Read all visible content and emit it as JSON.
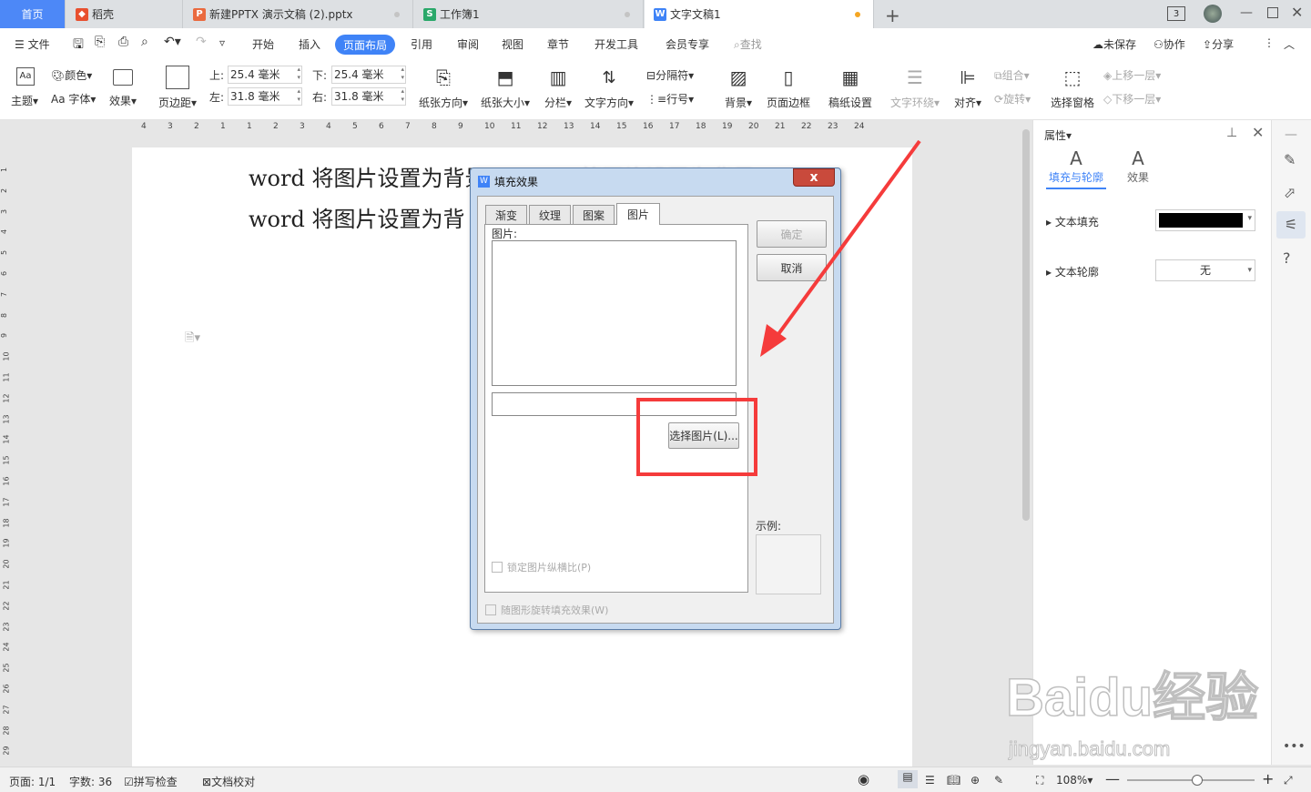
{
  "tabs": [
    {
      "label": "首页"
    },
    {
      "label": "稻壳"
    },
    {
      "label": "新建PPTX 演示文稿 (2).pptx"
    },
    {
      "label": "工作簿1"
    },
    {
      "label": "文字文稿1"
    }
  ],
  "tab_badge": "3",
  "menu": {
    "file": "文件",
    "items": [
      "开始",
      "插入",
      "页面布局",
      "引用",
      "审阅",
      "视图",
      "章节",
      "开发工具",
      "会员专享"
    ],
    "search": "查找",
    "unsaved": "未保存",
    "collab": "协作",
    "share": "分享"
  },
  "ribbon": {
    "theme": "主题",
    "color": "颜色",
    "font": "字体",
    "effect": "效果",
    "margins": "页边距",
    "top_label": "上:",
    "top_value": "25.4 毫米",
    "bottom_label": "下:",
    "bottom_value": "25.4 毫米",
    "left_label": "左:",
    "left_value": "31.8 毫米",
    "right_label": "右:",
    "right_value": "31.8 毫米",
    "orientation": "纸张方向",
    "size": "纸张大小",
    "columns": "分栏",
    "text_direction": "文字方向",
    "breaks": "分隔符",
    "line_numbers": "行号",
    "background": "背景",
    "page_border": "页面边框",
    "manuscript": "稿纸设置",
    "wrap": "文字环绕",
    "align": "对齐",
    "group": "组合",
    "rotate": "旋转",
    "selection_pane": "选择窗格",
    "bring_forward": "上移一层",
    "send_backward": "下移一层"
  },
  "ruler": {
    "h_ticks": [
      "4",
      "3",
      "2",
      "1",
      "1",
      "2",
      "3",
      "4",
      "5",
      "6",
      "7",
      "8",
      "9",
      "10",
      "11",
      "12",
      "13",
      "14",
      "15",
      "16",
      "17",
      "18",
      "19",
      "20",
      "21",
      "22",
      "23",
      "24"
    ],
    "v_ticks": [
      "1",
      "2",
      "3",
      "4",
      "5",
      "6",
      "7",
      "8",
      "9",
      "10",
      "11",
      "12",
      "13",
      "14",
      "15",
      "16",
      "17",
      "18",
      "19",
      "20",
      "21",
      "22",
      "23",
      "24",
      "25",
      "26",
      "27",
      "28",
      "29"
    ]
  },
  "document": {
    "line1": "word 将图片设置为背景",
    "line1b": "将图片设置为背景",
    "line2": "word 将图片设置为背"
  },
  "dialog": {
    "title": "填充效果",
    "close": "x",
    "tabs": [
      "渐变",
      "纹理",
      "图案",
      "图片"
    ],
    "picture_label": "图片:",
    "select_button": "选择图片(L)...",
    "lock_ratio": "锁定图片纵横比(P)",
    "rotate_fill": "随图形旋转填充效果(W)",
    "ok": "确定",
    "cancel": "取消",
    "sample": "示例:"
  },
  "panel": {
    "title": "属性",
    "tab_fill": "填充与轮廓",
    "tab_effect": "效果",
    "text_fill": "文本填充",
    "text_fill_color": "#000000",
    "text_outline": "文本轮廓",
    "text_outline_value": "无"
  },
  "status": {
    "page": "页面: 1/1",
    "words": "字数: 36",
    "spell": "拼写检查",
    "proof": "文档校对",
    "zoom": "108%",
    "zoom_level": 0.55
  },
  "watermark": {
    "brand": "Baidu经验",
    "url": "jingyan.baidu.com"
  },
  "colors": {
    "accent": "#3f83f7",
    "annotation": "#f53b3b"
  }
}
